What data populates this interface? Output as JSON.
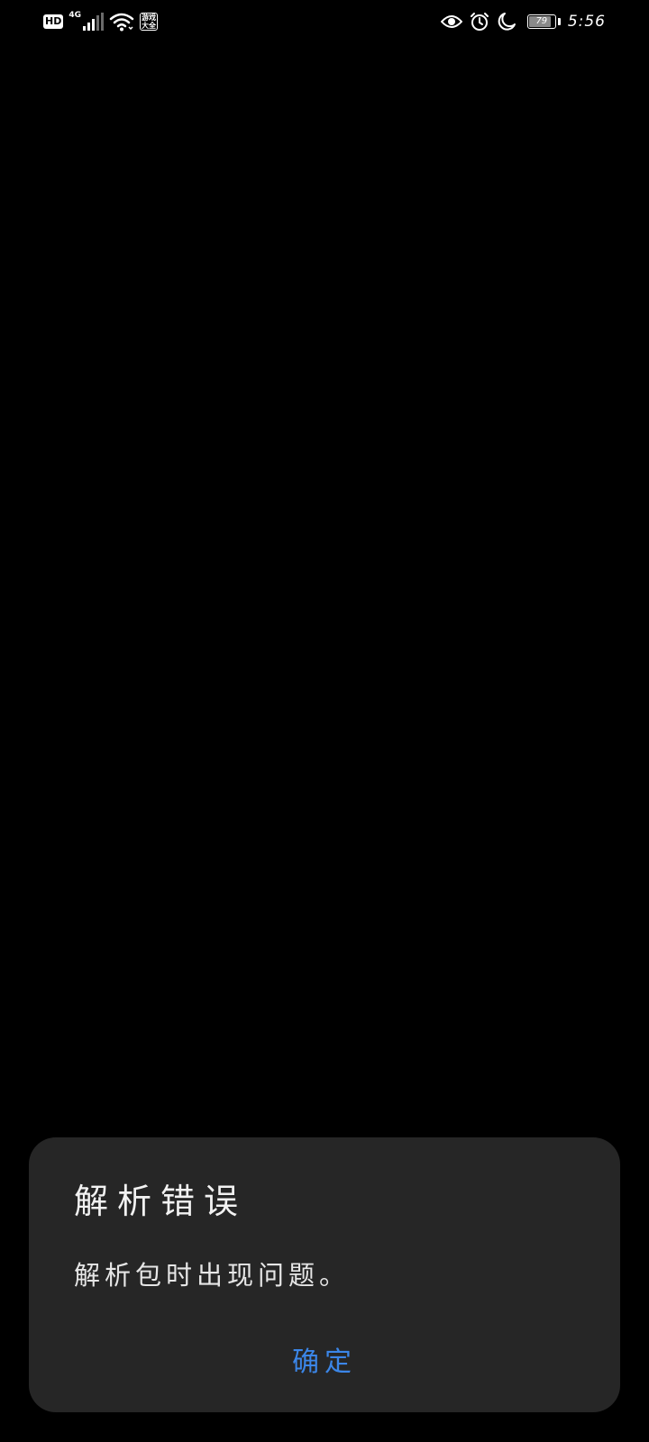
{
  "status_bar": {
    "hd_label": "HD",
    "network_label": "4G",
    "app_icon_text": "游戏大全",
    "battery_level": "79",
    "time": "5:56",
    "icons_left": [
      "hd-icon",
      "signal-icon",
      "wifi-icon",
      "app-notification-icon"
    ],
    "icons_right": [
      "eye-comfort-icon",
      "alarm-icon",
      "do-not-disturb-icon",
      "battery-icon"
    ]
  },
  "dialog": {
    "title": "解析错误",
    "message": "解析包时出现问题。",
    "confirm_label": "确定"
  },
  "colors": {
    "background": "#000000",
    "dialog_background": "#262626",
    "accent": "#3b86e8",
    "text": "#f2f2f2"
  }
}
